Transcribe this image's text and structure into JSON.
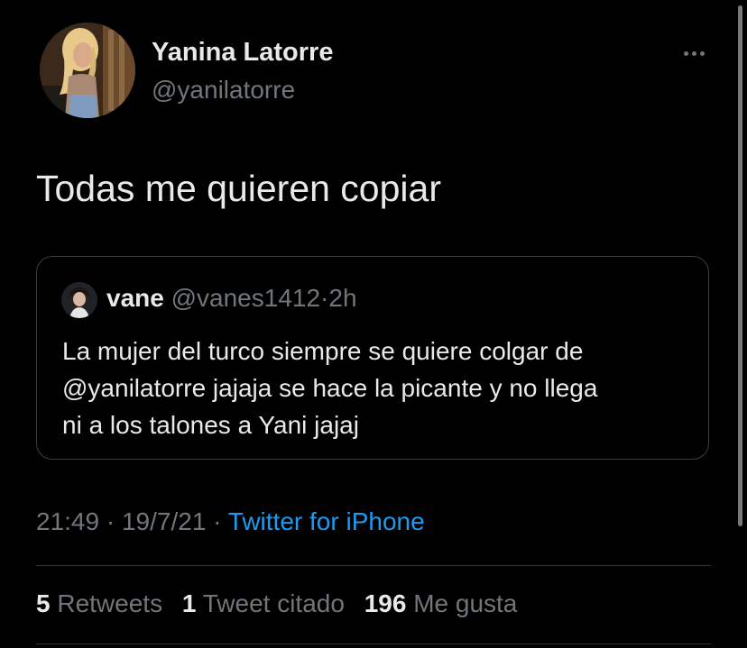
{
  "tweet": {
    "author_name": "Yanina Latorre",
    "author_handle": "@yanilatorre",
    "text": "Todas me quieren copiar",
    "time": "21:49",
    "date": "19/7/21",
    "source": "Twitter for iPhone",
    "separator": "·"
  },
  "quoted_tweet": {
    "author_name": "vane",
    "author_handle": "@vanes1412",
    "separator": "·",
    "time": "2h",
    "text_lines": [
      "La mujer del turco siempre se quiere colgar de",
      "@yanilatorre  jajaja se hace la picante y no llega",
      "ni a los talones a Yani jajaj"
    ]
  },
  "stats": {
    "retweets_count": "5",
    "retweets_label": "Retweets",
    "quotes_count": "1",
    "quotes_label": "Tweet citado",
    "likes_count": "196",
    "likes_label": "Me gusta"
  },
  "icons": {
    "more": "more-horizontal-icon"
  },
  "colors": {
    "background": "#000000",
    "primary_text": "#e7e9ea",
    "secondary_text": "#71767b",
    "link": "#1d9bf0",
    "border": "#2f3336"
  }
}
